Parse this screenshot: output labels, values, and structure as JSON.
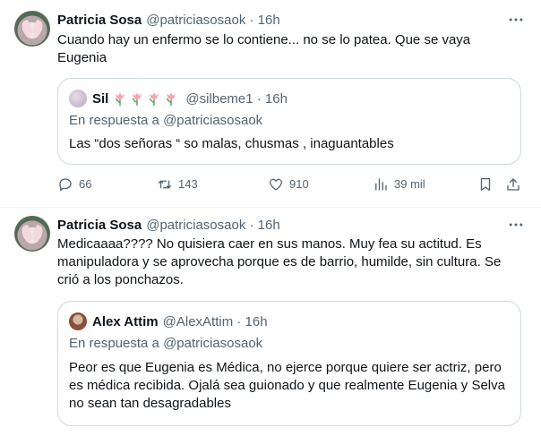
{
  "tweets": [
    {
      "author_name": "Patricia Sosa",
      "author_meta": "@patriciasosaok · 16h",
      "text": "Cuando hay un enfermo se lo contiene... no se lo patea. Que se vaya Eugenia",
      "quote": {
        "author_name": "Sil",
        "author_meta": "@silbeme1 · 16h",
        "reply_prefix": "En respuesta a",
        "reply_handle": "@patriciasosaok",
        "text": "Las “dos señoras “ so malas, chusmas , inaguantables"
      },
      "actions": {
        "replies": "66",
        "reposts": "143",
        "likes": "910",
        "views": "39 mil"
      }
    },
    {
      "author_name": "Patricia Sosa",
      "author_meta": "@patriciasosaok · 16h",
      "text": "Medicaaaa???? No quisiera caer en sus manos. Muy fea su actitud.  Es manipuladora y se aprovecha porque es de barrio, humilde, sin cultura. Se crió a los ponchazos.",
      "quote": {
        "author_name": "Alex Attim",
        "author_meta": "@AlexAttim · 16h",
        "reply_prefix": "En respuesta a",
        "reply_handle": "@patriciasosaok",
        "text": "Peor es que Eugenia es Médica, no ejerce porque quiere ser actriz, pero es médica recibida. Ojalá sea guionado y que realmente Eugenia y Selva no sean tan desagradables"
      }
    }
  ],
  "icons": {
    "more": "more-icon",
    "reply": "reply-icon",
    "repost": "repost-icon",
    "like": "like-icon",
    "views": "views-icon",
    "bookmark": "bookmark-icon",
    "share": "share-icon",
    "tulip": "tulip-emoji"
  },
  "colors": {
    "text": "#0f1419",
    "secondary": "#536471",
    "border": "#cfd9de",
    "divider": "#eff3f4"
  }
}
